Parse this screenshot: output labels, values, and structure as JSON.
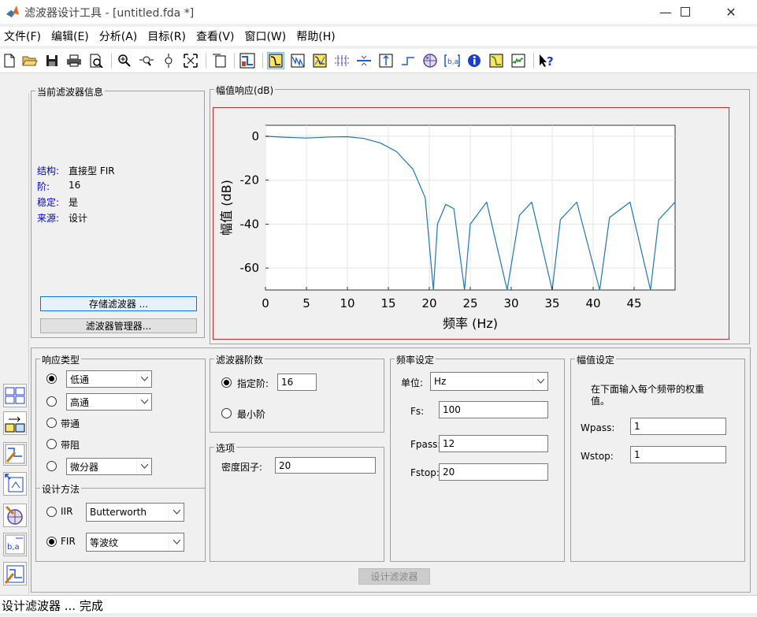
{
  "window": {
    "title": "滤波器设计工具 -  [untitled.fda *]"
  },
  "menu": [
    "文件(F)",
    "编辑(E)",
    "分析(A)",
    "目标(R)",
    "查看(V)",
    "窗口(W)",
    "帮助(H)"
  ],
  "toolbar_icons": [
    "new-icon",
    "open-icon",
    "save-icon",
    "print-icon",
    "print-preview-icon",
    "zoom-in-icon",
    "zoom-x-icon",
    "zoom-y-icon",
    "full-view-icon",
    "new-figure-icon",
    "filter-spec-icon",
    "magnitude-icon",
    "phase-icon",
    "mag-phase-icon",
    "group-delay-icon",
    "phase-delay-icon",
    "impulse-icon",
    "step-icon",
    "pole-zero-icon",
    "coefficients-icon",
    "info-icon",
    "magnitude-estimate-icon",
    "noise-psd-icon",
    "whats-this-icon"
  ],
  "filter_info": {
    "title": "当前滤波器信息",
    "rows": [
      {
        "label": "结构:",
        "value": "直接型 FIR"
      },
      {
        "label": "阶:",
        "value": "16"
      },
      {
        "label": "稳定:",
        "value": "是"
      },
      {
        "label": "来源:",
        "value": "设计"
      }
    ],
    "store_button": "存储滤波器 ...",
    "manager_button": "滤波器管理器..."
  },
  "plot_panel": {
    "title": "幅值响应(dB)"
  },
  "chart_data": {
    "type": "line",
    "title": "",
    "xlabel": "频率 (Hz)",
    "ylabel": "幅值 (dB)",
    "xlim": [
      0,
      50
    ],
    "ylim": [
      -70,
      5
    ],
    "xticks": [
      0,
      5,
      10,
      15,
      20,
      25,
      30,
      35,
      40,
      45
    ],
    "yticks": [
      0,
      -20,
      -40,
      -60
    ],
    "grid": true,
    "series": [
      {
        "name": "",
        "x": [
          0,
          2,
          5,
          8,
          10,
          12,
          14,
          16,
          18,
          19.5,
          20.5,
          21,
          22,
          23,
          24.3,
          25,
          27,
          29.5,
          31,
          32.5,
          35,
          36,
          38,
          40.8,
          42,
          44.5,
          47,
          48,
          50
        ],
        "y": [
          0,
          -0.4,
          -0.8,
          -0.3,
          -0.2,
          -1,
          -3,
          -7,
          -15,
          -28,
          -70,
          -40,
          -31,
          -33,
          -70,
          -40,
          -30,
          -70,
          -36,
          -30,
          -70,
          -38,
          -30,
          -70,
          -37,
          -30,
          -70,
          -38,
          -30
        ]
      }
    ]
  },
  "response_type": {
    "title": "响应类型",
    "options": [
      {
        "select": "低通"
      },
      {
        "select": "高通"
      },
      {
        "label": "带通"
      },
      {
        "label": "带阻"
      },
      {
        "select": "微分器"
      }
    ]
  },
  "design_method": {
    "title": "设计方法",
    "iir_label": "IIR",
    "iir_select": "Butterworth",
    "fir_label": "FIR",
    "fir_select": "等波纹"
  },
  "filter_order": {
    "title": "滤波器阶数",
    "specify_label": "指定阶:",
    "specify_value": "16",
    "minimum_label": "最小阶"
  },
  "options": {
    "title": "选项",
    "density_label": "密度因子:",
    "density_value": "20"
  },
  "freq_spec": {
    "title": "频率设定",
    "units_label": "单位:",
    "units_value": "Hz",
    "fs_label": "Fs:",
    "fs_value": "100",
    "fpass_label": "Fpass:",
    "fpass_value": "12",
    "fstop_label": "Fstop:",
    "fstop_value": "20"
  },
  "mag_spec": {
    "title": "幅值设定",
    "note": "在下面输入每个频带的权重值。",
    "wpass_label": "Wpass:",
    "wpass_value": "1",
    "wstop_label": "Wstop:",
    "wstop_value": "1"
  },
  "design_button": "设计滤波器",
  "status": "设计滤波器 ... 完成",
  "colors": {
    "curve": "#1f77b4",
    "highlight_border": "#d62728",
    "info_labels": "#0000d0"
  }
}
